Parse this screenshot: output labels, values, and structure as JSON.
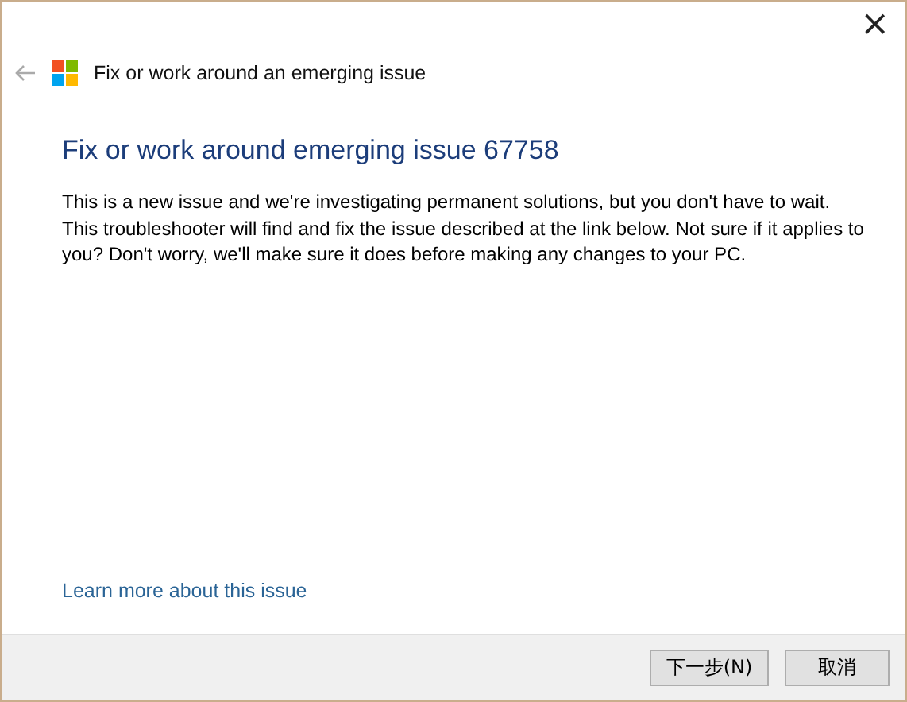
{
  "window": {
    "title": "Fix or work around an emerging issue",
    "close": "×"
  },
  "heading": "Fix or work around emerging issue 67758",
  "description": "This is a new issue and we're investigating permanent solutions, but you don't have to wait.  This troubleshooter will find and fix the issue described at the link below.  Not sure if it applies to you? Don't worry, we'll make sure it does before making any changes to your PC.",
  "link": "Learn more about this issue",
  "buttons": [
    {
      "label": "下一步(N)"
    },
    {
      "label": "取消"
    }
  ]
}
